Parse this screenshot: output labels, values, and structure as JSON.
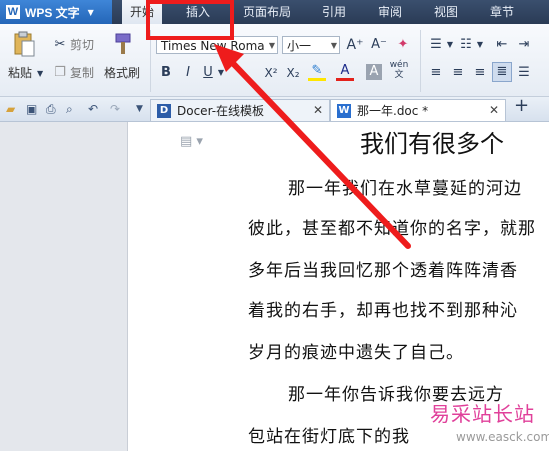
{
  "app": {
    "title": "WPS 文字",
    "logo_letter": "W"
  },
  "menu": {
    "tabs": [
      {
        "label": "开始"
      },
      {
        "label": "插入"
      },
      {
        "label": "页面布局"
      },
      {
        "label": "引用"
      },
      {
        "label": "审阅"
      },
      {
        "label": "视图"
      },
      {
        "label": "章节"
      }
    ]
  },
  "ribbon": {
    "paste": "粘贴",
    "cut": "剪切",
    "copy": "复制",
    "format_painter": "格式刷",
    "font_name": "Times New Roma",
    "font_size": "小一",
    "phonetic_glyph": "wén",
    "bold": "B",
    "italic": "I",
    "underline": "U",
    "superscript": "X²",
    "subscript": "X₂"
  },
  "tabs": [
    {
      "label": "Docer-在线模板"
    },
    {
      "label": "那一年.doc *"
    }
  ],
  "document": {
    "heading": "我们有很多个",
    "lines": [
      "那一年我们在水草蔓延的河边",
      "彼此，甚至都不知道你的名字，就那",
      "多年后当我回忆那个透着阵阵清香",
      "着我的右手，却再也找不到那种沁",
      "岁月的痕迹中遗失了自己。",
      "那一年你告诉我你要去远方",
      "包站在街灯底下的我"
    ]
  },
  "watermark": {
    "name": "易采站长站",
    "url": "www.easck.com"
  },
  "colors": {
    "highlight_red": "#ee1c1c",
    "accent_blue": "#2466b8"
  }
}
